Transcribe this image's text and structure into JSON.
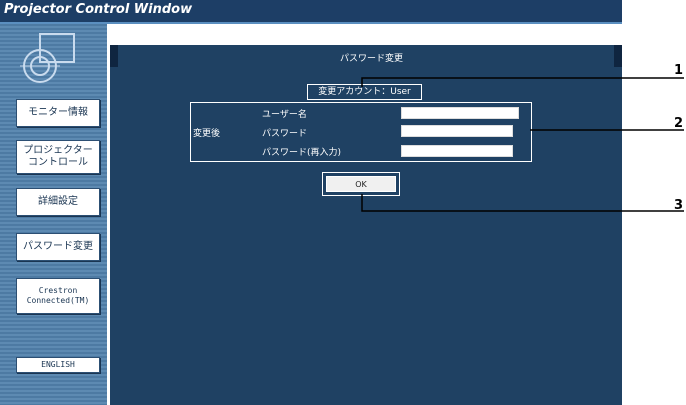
{
  "window": {
    "title": "Projector Control Window"
  },
  "sidebar": {
    "items": [
      {
        "label": "モニター情報"
      },
      {
        "label": "プロジェクター\nコントロール"
      },
      {
        "label": "詳細設定"
      },
      {
        "label": "パスワード変更"
      },
      {
        "label": "Crestron\nConnected(TM)"
      },
      {
        "label": "ENGLISH"
      }
    ]
  },
  "panel": {
    "title": "パスワード変更",
    "account_line": "変更アカウント：User",
    "form": {
      "group_label": "変更後",
      "username_label": "ユーザー名",
      "password_label": "パスワード",
      "password_confirm_label": "パスワード(再入力)",
      "username_value": "",
      "password_value": "",
      "password_confirm_value": ""
    },
    "ok_label": "OK"
  },
  "callouts": [
    "1",
    "2",
    "3"
  ]
}
